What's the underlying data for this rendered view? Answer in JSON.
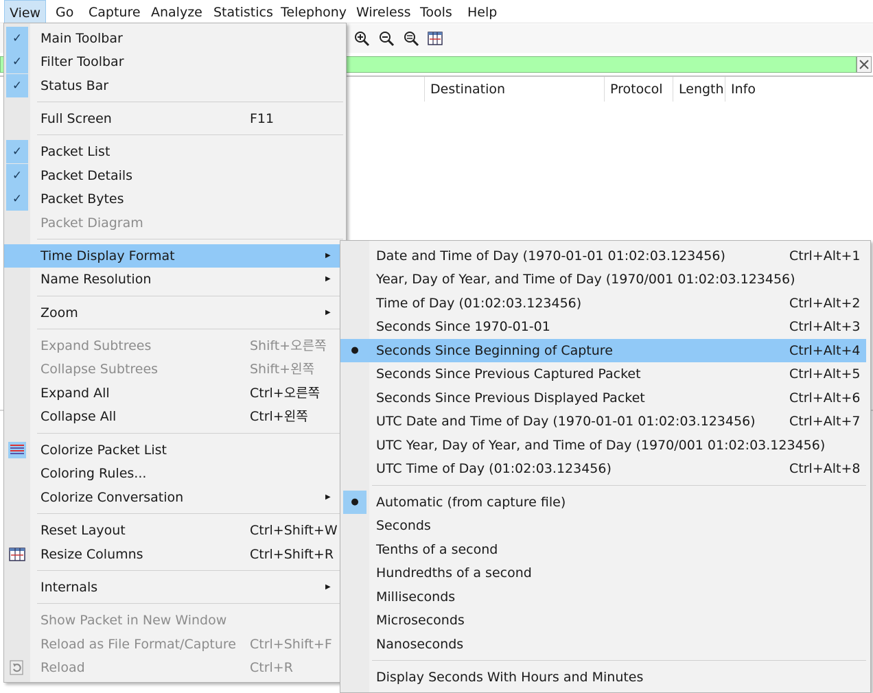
{
  "menubar": [
    "View",
    "Go",
    "Capture",
    "Analyze",
    "Statistics",
    "Telephony",
    "Wireless",
    "Tools",
    "Help"
  ],
  "columns": [
    "Destination",
    "Protocol",
    "Length",
    "Info"
  ],
  "colors": {
    "highlight": "#91c9f7",
    "check_bg": "#99cdf5",
    "filter_bg": "#aaffaa"
  },
  "view_menu": {
    "main_toolbar": "Main Toolbar",
    "filter_toolbar": "Filter Toolbar",
    "status_bar": "Status Bar",
    "full_screen": "Full Screen",
    "full_screen_sc": "F11",
    "packet_list": "Packet List",
    "packet_details": "Packet Details",
    "packet_bytes": "Packet Bytes",
    "packet_diagram": "Packet Diagram",
    "time_display_format": "Time Display Format",
    "name_resolution": "Name Resolution",
    "zoom": "Zoom",
    "expand_subtrees": "Expand Subtrees",
    "expand_subtrees_sc": "Shift+오른쪽",
    "collapse_subtrees": "Collapse Subtrees",
    "collapse_subtrees_sc": "Shift+왼쪽",
    "expand_all": "Expand All",
    "expand_all_sc": "Ctrl+오른쪽",
    "collapse_all": "Collapse All",
    "collapse_all_sc": "Ctrl+왼쪽",
    "colorize_packet_list": "Colorize Packet List",
    "coloring_rules": "Coloring Rules...",
    "colorize_conversation": "Colorize Conversation",
    "reset_layout": "Reset Layout",
    "reset_layout_sc": "Ctrl+Shift+W",
    "resize_columns": "Resize Columns",
    "resize_columns_sc": "Ctrl+Shift+R",
    "internals": "Internals",
    "show_packet_new_window": "Show Packet in New Window",
    "reload_as_file_format": "Reload as File Format/Capture",
    "reload_as_file_format_sc": "Ctrl+Shift+F",
    "reload": "Reload",
    "reload_sc": "Ctrl+R"
  },
  "time_menu": {
    "date_time_of_day": "Date and Time of Day (1970-01-01 01:02:03.123456)",
    "date_time_of_day_sc": "Ctrl+Alt+1",
    "year_doy_time": "Year, Day of Year, and Time of Day (1970/001 01:02:03.123456)",
    "time_of_day": "Time of Day (01:02:03.123456)",
    "time_of_day_sc": "Ctrl+Alt+2",
    "seconds_since_epoch": "Seconds Since 1970-01-01",
    "seconds_since_epoch_sc": "Ctrl+Alt+3",
    "seconds_since_beginning": "Seconds Since Beginning of Capture",
    "seconds_since_beginning_sc": "Ctrl+Alt+4",
    "seconds_since_prev_captured": "Seconds Since Previous Captured Packet",
    "seconds_since_prev_captured_sc": "Ctrl+Alt+5",
    "seconds_since_prev_displayed": "Seconds Since Previous Displayed Packet",
    "seconds_since_prev_displayed_sc": "Ctrl+Alt+6",
    "utc_date_time": "UTC Date and Time of Day (1970-01-01 01:02:03.123456)",
    "utc_date_time_sc": "Ctrl+Alt+7",
    "utc_year_doy_time": "UTC Year, Day of Year, and Time of Day (1970/001 01:02:03.123456)",
    "utc_time_of_day": "UTC Time of Day (01:02:03.123456)",
    "utc_time_of_day_sc": "Ctrl+Alt+8",
    "automatic": "Automatic (from capture file)",
    "seconds": "Seconds",
    "tenths": "Tenths of a second",
    "hundredths": "Hundredths of a second",
    "milliseconds": "Milliseconds",
    "microseconds": "Microseconds",
    "nanoseconds": "Nanoseconds",
    "display_hms": "Display Seconds With Hours and Minutes"
  }
}
